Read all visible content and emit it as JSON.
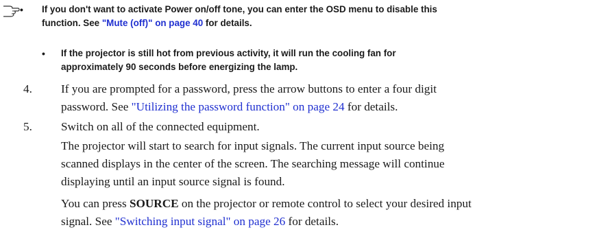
{
  "note": {
    "icon": "note-hand-icon",
    "bullets": [
      {
        "line1": "If you don't want to activate Power on/off tone, you can enter the OSD menu to disable this",
        "line2_prefix": "function",
        "line2_punct": ". ",
        "line2_see": "See ",
        "line2_link": "\"Mute (off)\" on page 40",
        "line2_suffix": " for details."
      },
      {
        "line1": "If the projector is still hot from previous activity, it will run the cooling fan for",
        "line2": "approximately 90 seconds before energizing the lamp."
      }
    ],
    "bullet_char": "•"
  },
  "steps": [
    {
      "number": "4.",
      "line1": "If you are prompted for a password, press the arrow buttons to enter a four digit",
      "line2_prefix": "password. See ",
      "line2_link": "\"Utilizing the password function\" on page 24",
      "line2_suffix": " for details."
    },
    {
      "number": "5.",
      "line1": "Switch on all of the connected equipment.",
      "para1": [
        "The projector will start to search for input signals. The current input source being",
        "scanned displays in the center of the screen. The searching message will continue",
        "displaying until an input source signal is found."
      ],
      "para2_line1_prefix": "You can press ",
      "para2_line1_key": "SOURCE",
      "para2_line1_suffix": " on the projector or remote control to select your desired input",
      "para2_line2_prefix": "signal. See ",
      "para2_line2_link": "\"Switching input signal\" on page 26",
      "para2_line2_suffix": " for details."
    }
  ]
}
